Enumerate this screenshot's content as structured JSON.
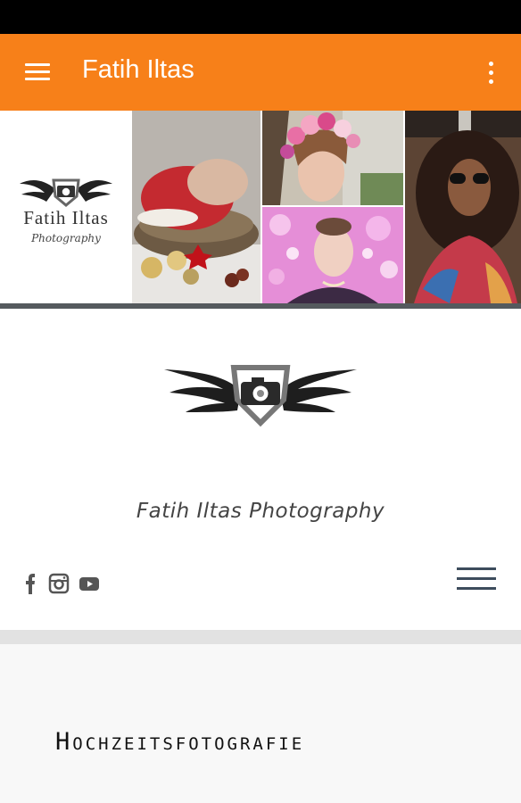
{
  "app_bar": {
    "title": "Fatih Iltas"
  },
  "banner": {
    "logo_name": "Fatih Iltas",
    "logo_script": "Photography"
  },
  "site": {
    "title": "Fatih Iltas Photography"
  },
  "social": [
    "facebook-icon",
    "instagram-icon",
    "youtube-icon"
  ],
  "content": {
    "heading": "Hochzeitsfotografie"
  },
  "colors": {
    "app_bar": "#f78019",
    "nav_icon": "#3d4c5c",
    "divider": "#e2e2e2"
  }
}
